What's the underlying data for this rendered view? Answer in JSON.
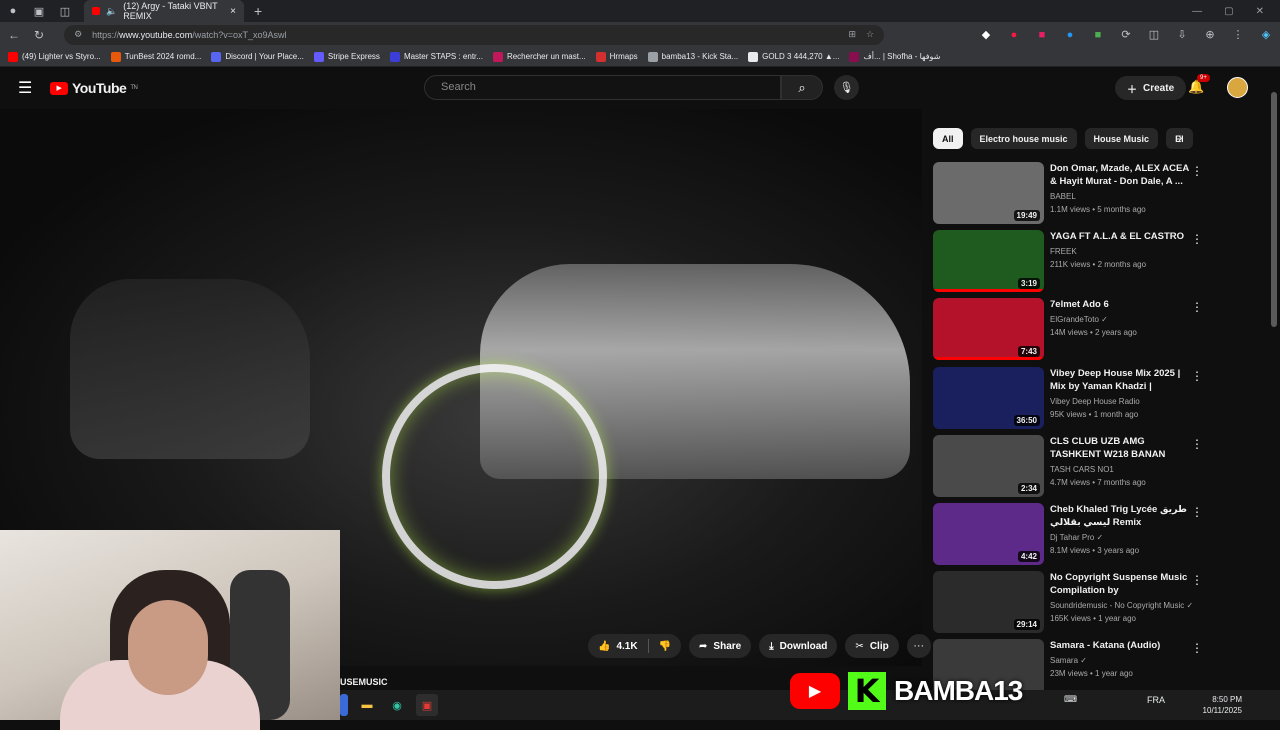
{
  "browser": {
    "tab_title": "(12) Argy - Tataki VBNT REMIX",
    "tab_close": "×",
    "new_tab": "+",
    "url_prefix": "https://",
    "url_host": "www.youtube.com",
    "url_path": "/watch?v=oxT_xo9Aswl",
    "bookmarks": [
      {
        "label": "(49) Lighter vs Styro...",
        "color": "#ff0000"
      },
      {
        "label": "TunBest 2024 romd...",
        "color": "#e8590c"
      },
      {
        "label": "Discord | Your Place...",
        "color": "#5865f2"
      },
      {
        "label": "Stripe Express",
        "color": "#635bff"
      },
      {
        "label": "Master STAPS : entr...",
        "color": "#3b3fd8"
      },
      {
        "label": "Rechercher un mast...",
        "color": "#c2185b"
      },
      {
        "label": "Hrmaps",
        "color": "#d32f2f"
      },
      {
        "label": "bamba13 - Kick Sta...",
        "color": "#9aa0a6"
      },
      {
        "label": "GOLD 3 444,270 ▲...",
        "color": "#e8eaed"
      },
      {
        "label": "أف... | Shofha - شوفها",
        "color": "#880e4f"
      }
    ]
  },
  "youtube": {
    "logo_text": "YouTube",
    "logo_region": "TN",
    "search_placeholder": "Search",
    "create_label": "Create",
    "notif_count": "9+",
    "actions": {
      "likes": "4.1K",
      "share": "Share",
      "download": "Download",
      "clip": "Clip",
      "more": "···"
    },
    "channel_partial": "USEMUSIC",
    "chips": [
      "All",
      "Electro house music",
      "House Music",
      "El"
    ],
    "recommendations": [
      {
        "title": "Don Omar, Mzade, ALEX ACEA & Hayit Murat - Don Dale, A ...",
        "channel": "BABEL",
        "meta": "1.1M views • 5 months ago",
        "duration": "19:49",
        "thumb": "#6b6b6b",
        "progress": 0
      },
      {
        "title": "YAGA FT A.L.A & EL CASTRO",
        "channel": "FREEK",
        "meta": "211K views • 2 months ago",
        "duration": "3:19",
        "thumb": "#1f5a1f",
        "progress": 1
      },
      {
        "title": "7elmet Ado 6",
        "channel": "ElGrandeToto ✓",
        "meta": "14M views • 2 years ago",
        "duration": "7:43",
        "thumb": "#b3122a",
        "progress": 1
      },
      {
        "title": "Vibey Deep House Mix 2025 | Mix by Yaman Khadzi | Selecte...",
        "channel": "Vibey Deep House Radio",
        "meta": "95K views • 1 month ago",
        "duration": "36:50",
        "thumb": "#1a1f5e",
        "progress": 0
      },
      {
        "title": "CLS CLUB UZB AMG TASHKENT W218 BANAN",
        "channel": "TASH CARS NO1",
        "meta": "4.7M views • 7 months ago",
        "duration": "2:34",
        "thumb": "#4a4a4a",
        "progress": 0
      },
      {
        "title": "Cheb Khaled  Trig Lycée طريق ليسي بقلالي Remix @djtaharpro",
        "channel": "Dj Tahar Pro ✓",
        "meta": "8.1M views • 3 years ago",
        "duration": "4:42",
        "thumb": "#5e2a8a",
        "progress": 0
      },
      {
        "title": "No Copyright Suspense Music Compilation by Soundridemusi...",
        "channel": "Soundridemusic - No Copyright Music ✓",
        "meta": "165K views • 1 year ago",
        "duration": "29:14",
        "thumb": "#2b2b2b",
        "progress": 0
      },
      {
        "title": "Samara - Katana (Audio)",
        "channel": "Samara ✓",
        "meta": "23M views • 1 year ago",
        "duration": "",
        "thumb": "#3a3a3a",
        "progress": 0
      }
    ]
  },
  "overlay": {
    "streamer_name": "BAMBA13",
    "kick_letter": "K"
  },
  "taskbar": {
    "language": "FRA",
    "time": "8:50 PM",
    "date": "10/11/2025"
  }
}
